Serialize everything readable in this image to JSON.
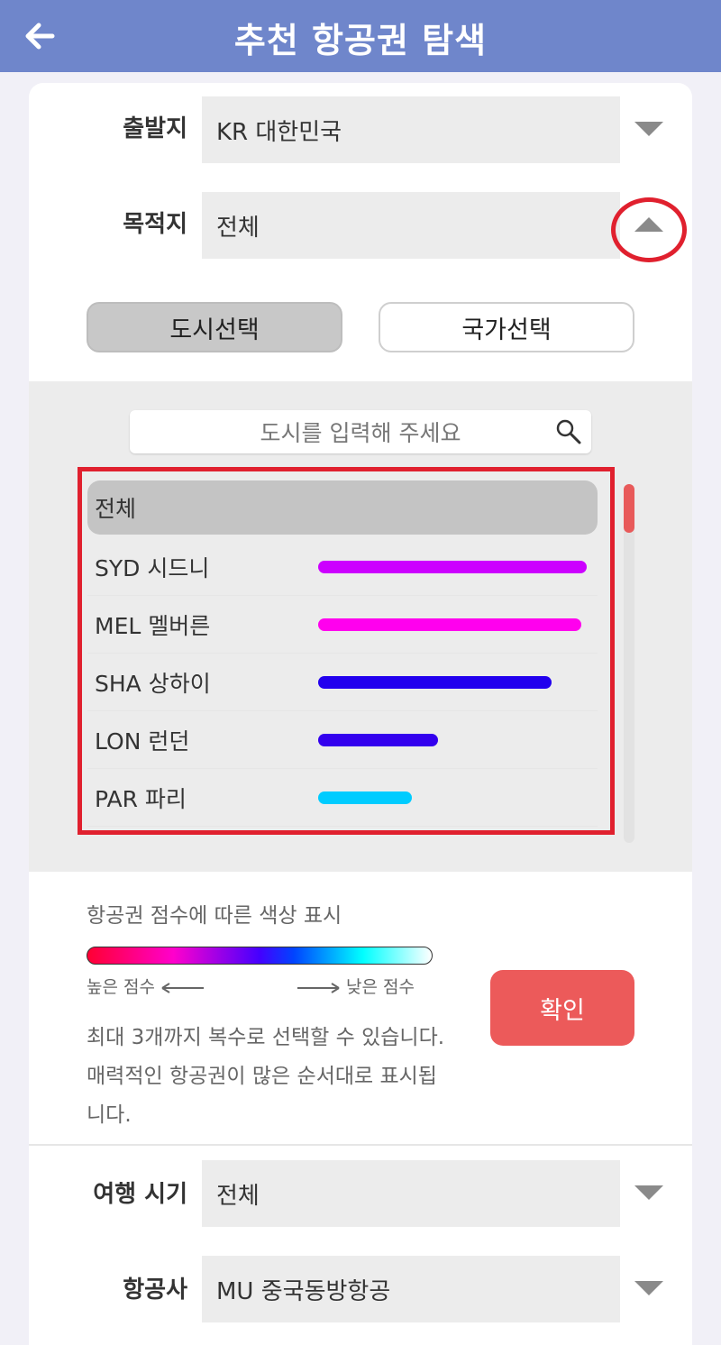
{
  "header": {
    "title": "추천 항공권 탐색",
    "back_icon": "back-arrow-icon"
  },
  "departure": {
    "label": "출발지",
    "value": "KR 대한민국"
  },
  "destination": {
    "label": "목적지",
    "value": "전체"
  },
  "toggle": {
    "city": "도시선택",
    "country": "국가선택",
    "active": "city"
  },
  "search": {
    "placeholder": "도시를 입력해 주세요"
  },
  "list": {
    "items": [
      {
        "label": "전체",
        "selected": true
      },
      {
        "label": "SYD 시드니",
        "score": 0.92,
        "color": "#cc00ff"
      },
      {
        "label": "MEL 멜버른",
        "score": 0.9,
        "color": "#ff00ee"
      },
      {
        "label": "SHA 상하이",
        "score": 0.8,
        "color": "#2200ee"
      },
      {
        "label": "LON 런던",
        "score": 0.41,
        "color": "#3300ee"
      },
      {
        "label": "PAR 파리",
        "score": 0.32,
        "color": "#00ccff"
      }
    ]
  },
  "legend": {
    "title": "항공권 점수에 따른 색상 표시",
    "high": "높은 점수",
    "low": "낮은 점수"
  },
  "description": "최대 3개까지 복수로 선택할 수 있습니다. 매력적인 항공권이 많은 순서대로 표시됩니다.",
  "confirm_label": "확인",
  "travel_period": {
    "label": "여행 시기",
    "value": "전체"
  },
  "airline": {
    "label": "항공사",
    "value": "MU 중국동방항공"
  },
  "colors": {
    "header_bg": "#6f86cb",
    "confirm_bg": "#ec5a5a",
    "highlight": "#e0202e"
  }
}
